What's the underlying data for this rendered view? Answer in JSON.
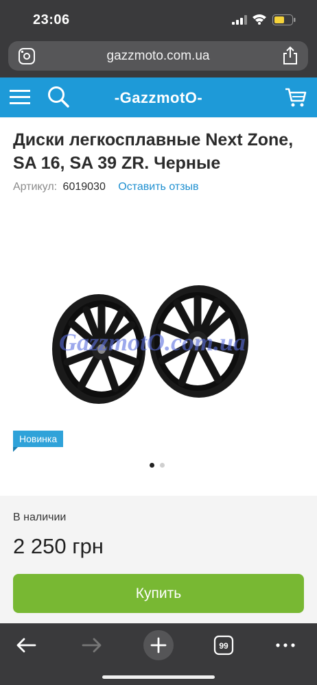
{
  "status_bar": {
    "time": "23:06"
  },
  "browser": {
    "url": "gazzmoto.com.ua",
    "tab_count": "99"
  },
  "site": {
    "logo": "-GazzmotO-"
  },
  "product": {
    "title": "Диски легкосплавные Next Zone, SA 16, SA 39 ZR. Черные",
    "sku_label": "Артикул:",
    "sku": "6019030",
    "review_link": "Оставить отзыв",
    "badge": "Новинка",
    "watermark": "GazzmotO.com.ua",
    "gallery": {
      "slides": 2,
      "active": 1
    }
  },
  "purchase": {
    "stock": "В наличии",
    "price": "2 250 грн",
    "buy_label": "Купить"
  },
  "colors": {
    "header_blue": "#1e9ad8",
    "buy_green": "#78b833",
    "badge_blue": "#2fa2d9",
    "link_blue": "#1e8fd0"
  },
  "icons": [
    "reader-icon",
    "share-icon",
    "menu-icon",
    "search-icon",
    "cart-icon",
    "back-icon",
    "forward-icon",
    "plus-icon",
    "tabs-icon",
    "more-icon"
  ]
}
